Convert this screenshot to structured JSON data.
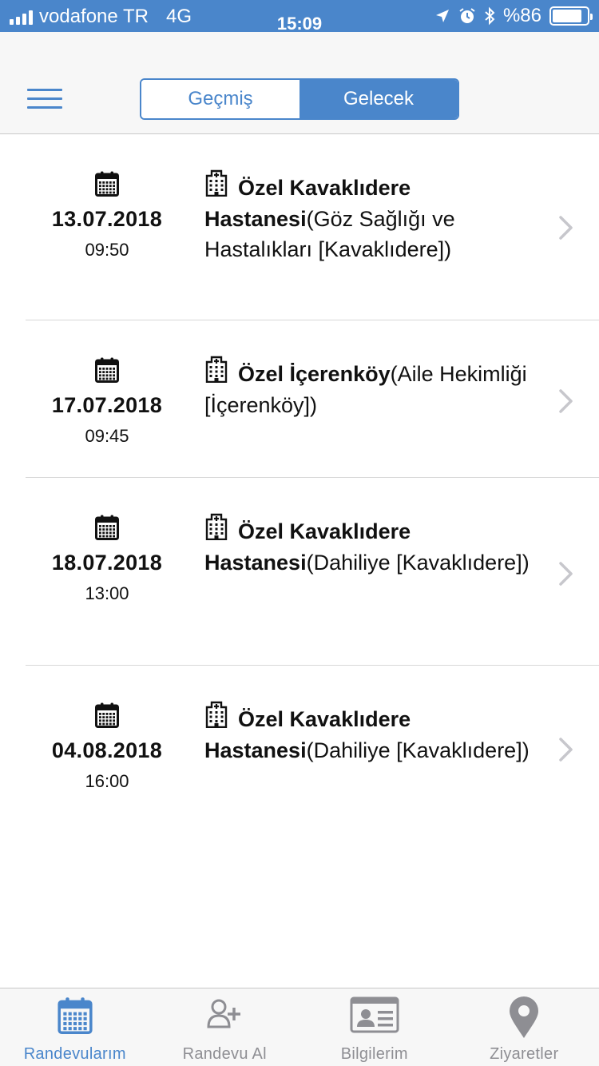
{
  "status_bar": {
    "carrier": "vodafone TR",
    "network": "4G",
    "time": "15:09",
    "battery_text": "%86",
    "battery_level": 0.86
  },
  "nav": {
    "segments": [
      {
        "label": "Geçmiş",
        "active": false
      },
      {
        "label": "Gelecek",
        "active": true
      }
    ]
  },
  "appointments": [
    {
      "date": "13.07.2018",
      "time": "09:50",
      "name": "Özel Kavaklıdere Hastanesi",
      "detail": "(Göz Sağlığı ve Hastalıkları [Kavaklıdere])"
    },
    {
      "date": "17.07.2018",
      "time": "09:45",
      "name": "Özel İçerenköy",
      "detail": "(Aile Hekimliği [İçerenköy])"
    },
    {
      "date": "18.07.2018",
      "time": "13:00",
      "name": "Özel Kavaklıdere Hastanesi",
      "detail": "(Dahiliye [Kavaklıdere])"
    },
    {
      "date": "04.08.2018",
      "time": "16:00",
      "name": "Özel Kavaklıdere Hastanesi",
      "detail": "(Dahiliye [Kavaklıdere])"
    }
  ],
  "tab_bar": {
    "tabs": [
      {
        "label": "Randevularım",
        "icon": "calendar-icon",
        "active": true
      },
      {
        "label": "Randevu Al",
        "icon": "add-user-icon",
        "active": false
      },
      {
        "label": "Bilgilerim",
        "icon": "id-card-icon",
        "active": false
      },
      {
        "label": "Ziyaretler",
        "icon": "map-pin-icon",
        "active": false
      }
    ]
  },
  "colors": {
    "accent": "#4A86CB",
    "inactive": "#8E8E93",
    "separator": "#D8D8D8"
  }
}
